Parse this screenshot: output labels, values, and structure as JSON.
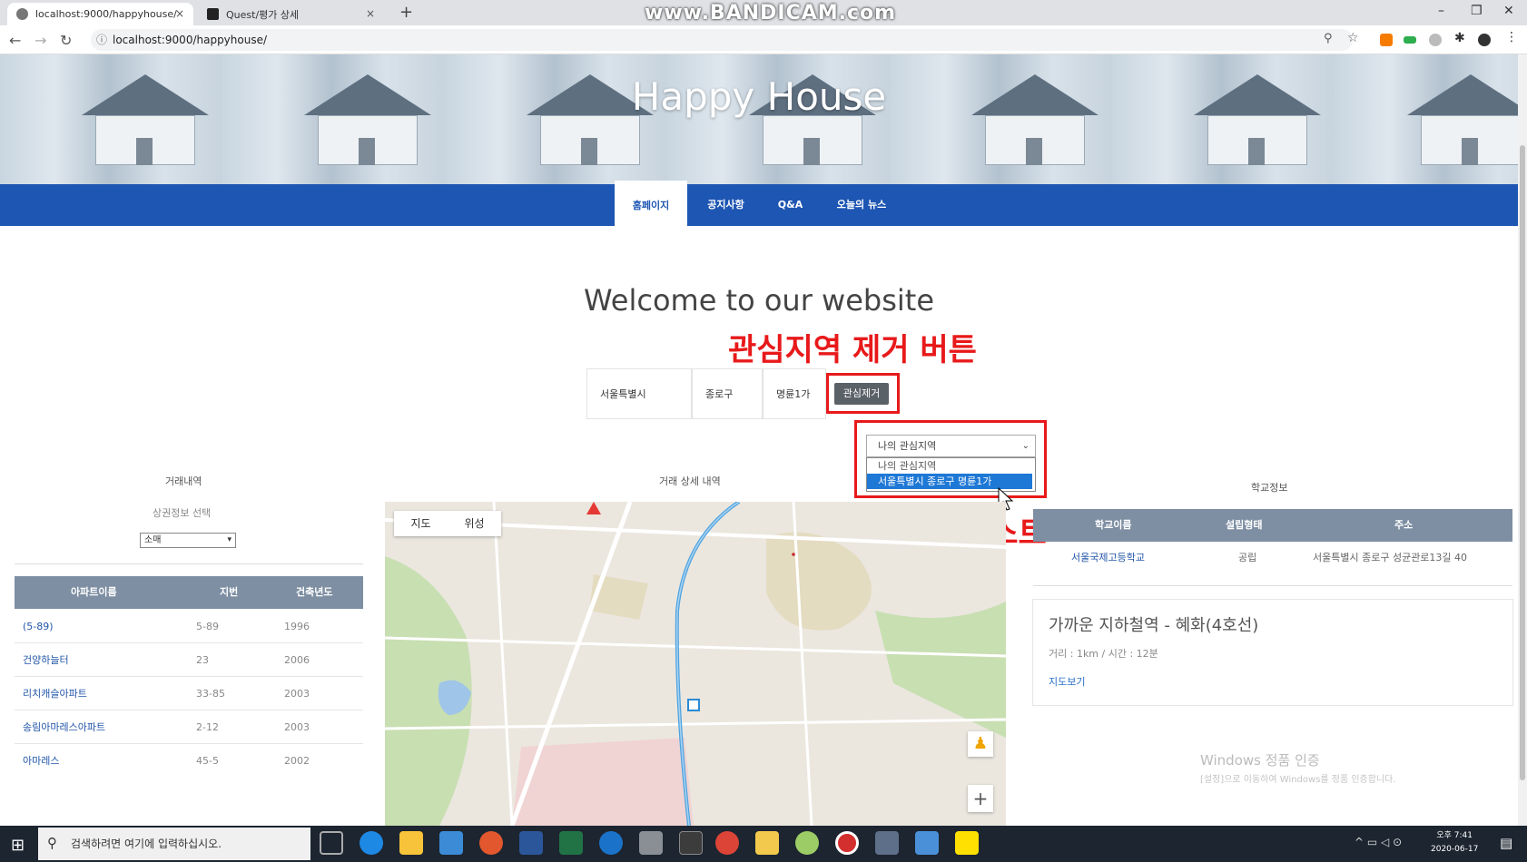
{
  "browser": {
    "tabs": [
      {
        "title": "localhost:9000/happyhouse/",
        "close": "×"
      },
      {
        "title": "Quest/평가 상세",
        "close": "×"
      }
    ],
    "new_tab": "+",
    "watermark": "www.BANDICAM.com",
    "url": "localhost:9000/happyhouse/",
    "controls": {
      "minimize": "–",
      "maximize": "❐",
      "close": "✕"
    }
  },
  "site": {
    "title": "Happy House",
    "nav": [
      {
        "label": "홈페이지",
        "active": true
      },
      {
        "label": "공지사항",
        "active": false
      },
      {
        "label": "Q&A",
        "active": false
      },
      {
        "label": "오늘의 뉴스",
        "active": false
      }
    ],
    "welcome": "Welcome to our website"
  },
  "annotations": {
    "remove_button": "관심지역 제거 버튼",
    "favorites_list": "관심지역 리스트"
  },
  "location": {
    "city": "서울특별시",
    "district": "종로구",
    "dong": "명륜1가",
    "remove_label": "관심제거"
  },
  "favorites": {
    "selected": "나의 관심지역",
    "options": [
      "나의 관심지역",
      "서울특별시 종로구 명륜1가"
    ]
  },
  "left_panel": {
    "label": "거래내역",
    "sublabel": "상권정보 선택",
    "select_value": "소매",
    "columns": [
      "아파트이름",
      "지번",
      "건축년도"
    ],
    "rows": [
      {
        "name": "(5-89)",
        "lot": "5-89",
        "year": "1996"
      },
      {
        "name": "건양하늘터",
        "lot": "23",
        "year": "2006"
      },
      {
        "name": "리치캐슬아파트",
        "lot": "33-85",
        "year": "2003"
      },
      {
        "name": "송림아마레스아파트",
        "lot": "2-12",
        "year": "2003"
      },
      {
        "name": "아마레스",
        "lot": "45-5",
        "year": "2002"
      }
    ]
  },
  "center_panel": {
    "label": "거래 상세 내역",
    "map_tabs": [
      "지도",
      "위성"
    ]
  },
  "right_panel": {
    "label": "학교정보",
    "columns": [
      "학교이름",
      "설립형태",
      "주소"
    ],
    "school": {
      "name": "서울국제고등학교",
      "type": "공립",
      "address": "서울특별시 종로구 성균관로13길 40"
    },
    "subway": {
      "title": "가까운 지하철역 - 혜화(4호선)",
      "info": "거리 : 1km / 시간 : 12분",
      "link": "지도보기"
    }
  },
  "windows": {
    "activate_title": "Windows 정품 인증",
    "activate_sub": "[설정]으로 이동하여 Windows를 정품 인증합니다.",
    "search_placeholder": "검색하려면 여기에 입력하십시오.",
    "time": "오후 7:41",
    "date": "2020-06-17"
  },
  "colors": {
    "nav_blue": "#1e56b3",
    "table_head": "#7e8fa3",
    "annotation_red": "#e8191a"
  }
}
